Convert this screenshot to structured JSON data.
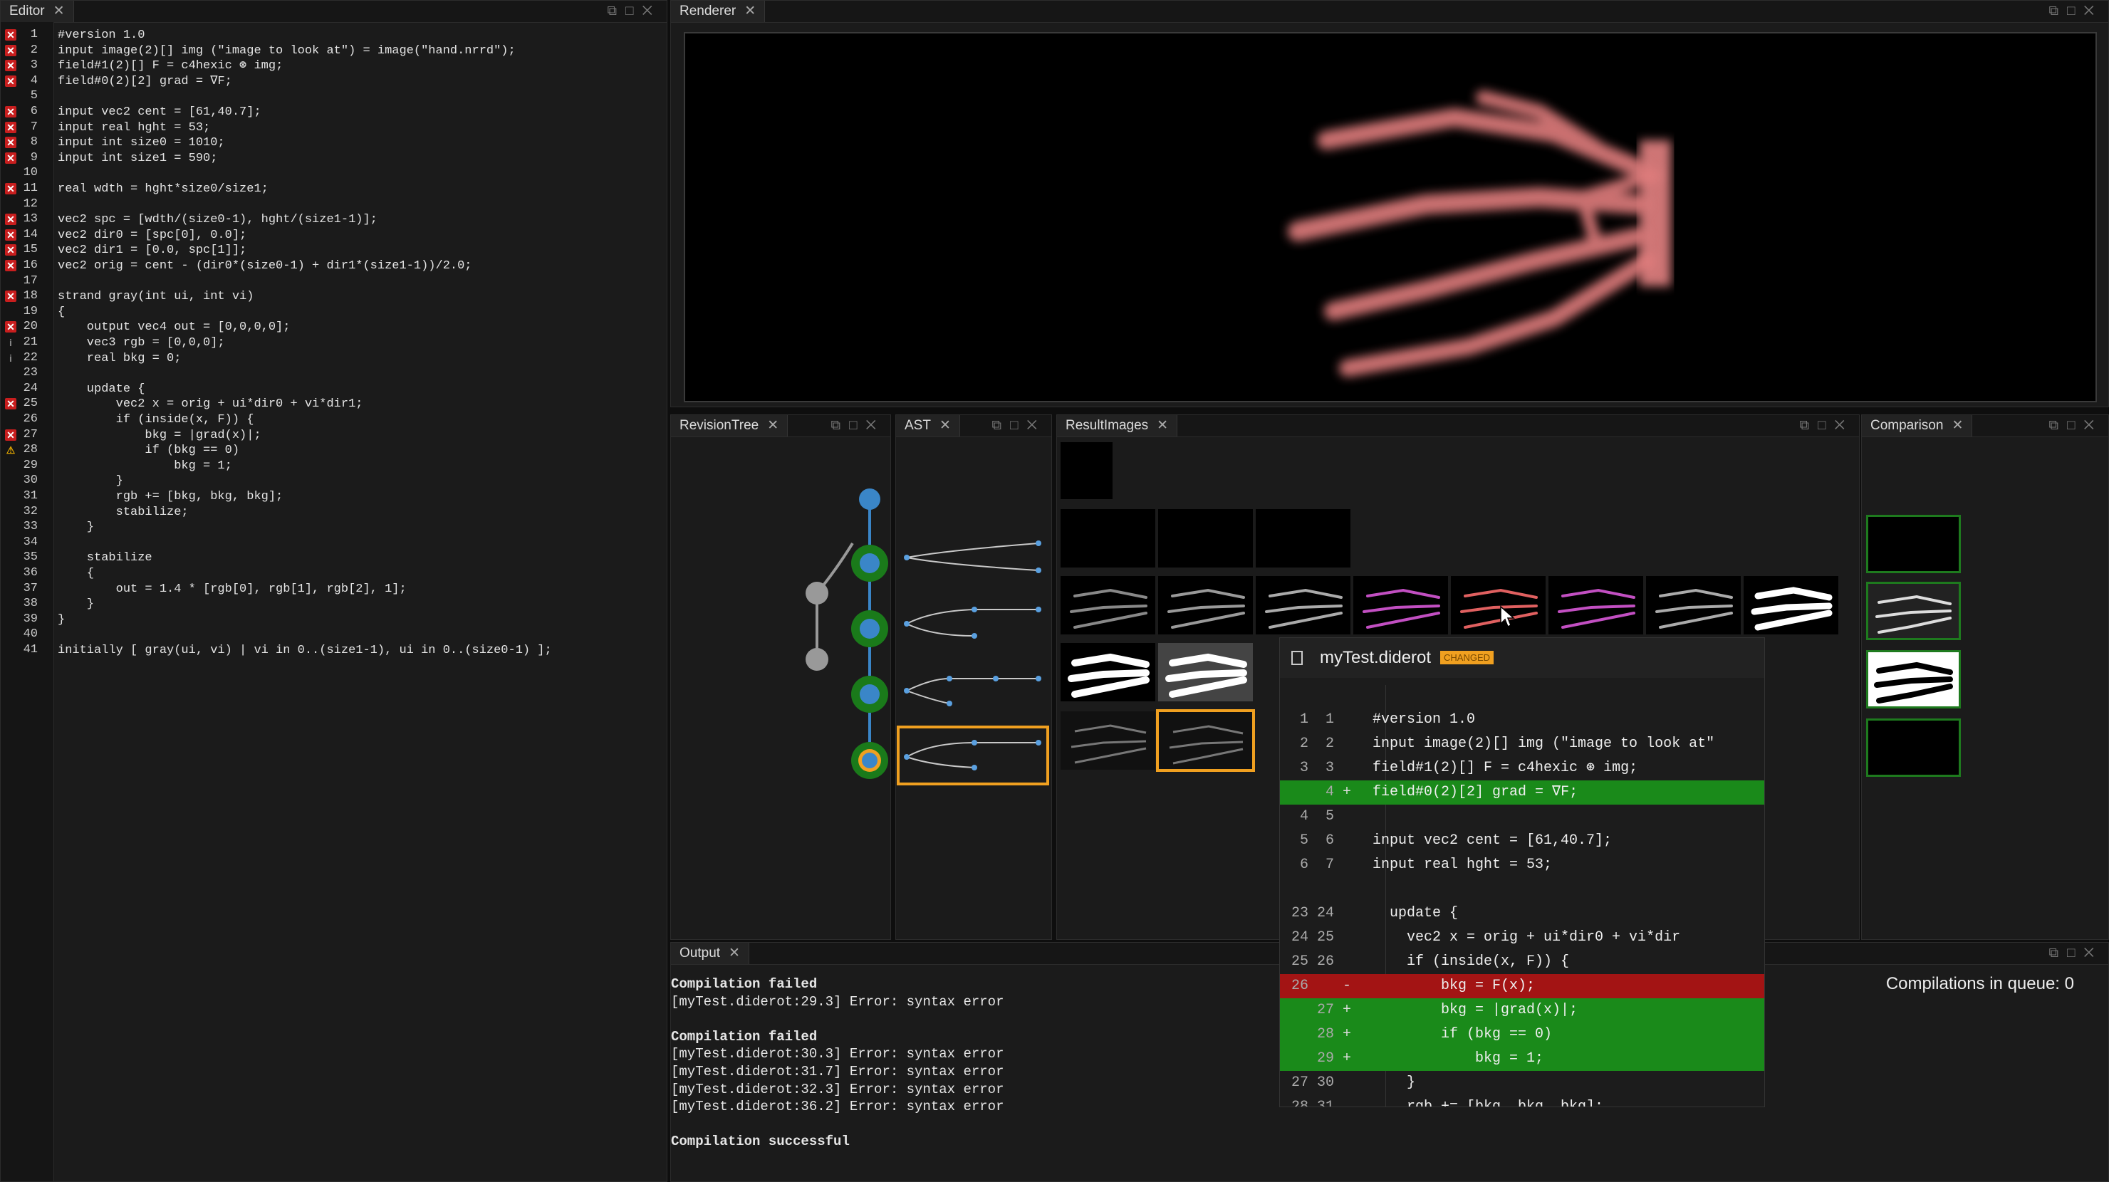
{
  "editor": {
    "tab": "Editor",
    "lines": [
      {
        "n": "1",
        "m": "err",
        "t": "#version 1.0"
      },
      {
        "n": "2",
        "m": "err",
        "t": "input image(2)[] img (\"image to look at\") = image(\"hand.nrrd\");"
      },
      {
        "n": "3",
        "m": "err",
        "t": "field#1(2)[] F = c4hexic ⊛ img;"
      },
      {
        "n": "4",
        "m": "err",
        "t": "field#0(2)[2] grad = ∇F;"
      },
      {
        "n": "5",
        "m": "",
        "t": ""
      },
      {
        "n": "6",
        "m": "err",
        "t": "input vec2 cent = [61,40.7];"
      },
      {
        "n": "7",
        "m": "err",
        "t": "input real hght = 53;"
      },
      {
        "n": "8",
        "m": "err",
        "t": "input int size0 = 1010;"
      },
      {
        "n": "9",
        "m": "err",
        "t": "input int size1 = 590;"
      },
      {
        "n": "10",
        "m": "",
        "t": ""
      },
      {
        "n": "11",
        "m": "err",
        "t": "real wdth = hght*size0/size1;"
      },
      {
        "n": "12",
        "m": "",
        "t": ""
      },
      {
        "n": "13",
        "m": "err",
        "t": "vec2 spc = [wdth/(size0-1), hght/(size1-1)];"
      },
      {
        "n": "14",
        "m": "err",
        "t": "vec2 dir0 = [spc[0], 0.0];"
      },
      {
        "n": "15",
        "m": "err",
        "t": "vec2 dir1 = [0.0, spc[1]];"
      },
      {
        "n": "16",
        "m": "err",
        "t": "vec2 orig = cent - (dir0*(size0-1) + dir1*(size1-1))/2.0;"
      },
      {
        "n": "17",
        "m": "",
        "t": ""
      },
      {
        "n": "18",
        "m": "err",
        "t": "strand gray(int ui, int vi)"
      },
      {
        "n": "19",
        "m": "",
        "t": "{"
      },
      {
        "n": "20",
        "m": "err",
        "t": "    output vec4 out = [0,0,0,0];"
      },
      {
        "n": "21",
        "m": "info",
        "t": "    vec3 rgb = [0,0,0];"
      },
      {
        "n": "22",
        "m": "info",
        "t": "    real bkg = 0;"
      },
      {
        "n": "23",
        "m": "",
        "t": ""
      },
      {
        "n": "24",
        "m": "",
        "t": "    update {"
      },
      {
        "n": "25",
        "m": "err",
        "t": "        vec2 x = orig + ui*dir0 + vi*dir1;"
      },
      {
        "n": "26",
        "m": "",
        "t": "        if (inside(x, F)) {"
      },
      {
        "n": "27",
        "m": "err",
        "t": "            bkg = |grad(x)|;"
      },
      {
        "n": "28",
        "m": "warn",
        "t": "            if (bkg == 0)"
      },
      {
        "n": "29",
        "m": "",
        "t": "                bkg = 1;"
      },
      {
        "n": "30",
        "m": "",
        "t": "        }"
      },
      {
        "n": "31",
        "m": "",
        "t": "        rgb += [bkg, bkg, bkg];"
      },
      {
        "n": "32",
        "m": "",
        "t": "        stabilize;"
      },
      {
        "n": "33",
        "m": "",
        "t": "    }"
      },
      {
        "n": "34",
        "m": "",
        "t": ""
      },
      {
        "n": "35",
        "m": "",
        "t": "    stabilize"
      },
      {
        "n": "36",
        "m": "",
        "t": "    {"
      },
      {
        "n": "37",
        "m": "",
        "t": "        out = 1.4 * [rgb[0], rgb[1], rgb[2], 1];"
      },
      {
        "n": "38",
        "m": "",
        "t": "    }"
      },
      {
        "n": "39",
        "m": "",
        "t": "}"
      },
      {
        "n": "40",
        "m": "",
        "t": ""
      },
      {
        "n": "41",
        "m": "",
        "t": "initially [ gray(ui, vi) | vi in 0..(size1-1), ui in 0..(size0-1) ];"
      }
    ]
  },
  "renderer": {
    "tab": "Renderer"
  },
  "revision_tree": {
    "tab": "RevisionTree"
  },
  "ast": {
    "tab": "AST"
  },
  "result_images": {
    "tab": "ResultImages"
  },
  "comparison": {
    "tab": "Comparison"
  },
  "diff": {
    "filename": "myTest.diderot",
    "badge": "CHANGED",
    "rows": [
      {
        "a": "1",
        "b": "1",
        "s": "",
        "t": "#version 1.0",
        "k": "n"
      },
      {
        "a": "2",
        "b": "2",
        "s": "",
        "t": "input image(2)[] img (\"image to look at\"",
        "k": "n"
      },
      {
        "a": "3",
        "b": "3",
        "s": "",
        "t": "field#1(2)[] F = c4hexic ⊛ img;",
        "k": "n"
      },
      {
        "a": "",
        "b": "4",
        "s": "+",
        "t": "field#0(2)[2] grad = ∇F;",
        "k": "add"
      },
      {
        "a": "4",
        "b": "5",
        "s": "",
        "t": "",
        "k": "n"
      },
      {
        "a": "5",
        "b": "6",
        "s": "",
        "t": "input vec2 cent = [61,40.7];",
        "k": "n"
      },
      {
        "a": "6",
        "b": "7",
        "s": "",
        "t": "input real hght = 53;",
        "k": "n"
      },
      {
        "a": "",
        "b": "",
        "s": "",
        "t": "",
        "k": "n"
      },
      {
        "a": "23",
        "b": "24",
        "s": "",
        "t": "  update {",
        "k": "n"
      },
      {
        "a": "24",
        "b": "25",
        "s": "",
        "t": "    vec2 x = orig + ui*dir0 + vi*dir",
        "k": "n"
      },
      {
        "a": "25",
        "b": "26",
        "s": "",
        "t": "    if (inside(x, F)) {",
        "k": "n"
      },
      {
        "a": "26",
        "b": "",
        "s": "-",
        "t": "        bkg = F(x);",
        "k": "del"
      },
      {
        "a": "",
        "b": "27",
        "s": "+",
        "t": "        bkg = |grad(x)|;",
        "k": "add"
      },
      {
        "a": "",
        "b": "28",
        "s": "+",
        "t": "        if (bkg == 0)",
        "k": "add"
      },
      {
        "a": "",
        "b": "29",
        "s": "+",
        "t": "            bkg = 1;",
        "k": "add"
      },
      {
        "a": "27",
        "b": "30",
        "s": "",
        "t": "    }",
        "k": "n"
      },
      {
        "a": "28",
        "b": "31",
        "s": "",
        "t": "    rgb += [bkg, bkg, bkg];",
        "k": "n"
      }
    ]
  },
  "output": {
    "tab": "Output",
    "lines": [
      {
        "t": "Compilation failed",
        "b": true
      },
      {
        "t": "[myTest.diderot:29.3] Error: syntax error",
        "b": false
      },
      {
        "t": "",
        "b": false
      },
      {
        "t": "Compilation failed",
        "b": true
      },
      {
        "t": "[myTest.diderot:30.3] Error: syntax error",
        "b": false
      },
      {
        "t": "[myTest.diderot:31.7] Error: syntax error",
        "b": false
      },
      {
        "t": "[myTest.diderot:32.3] Error: syntax error",
        "b": false
      },
      {
        "t": "[myTest.diderot:36.2] Error: syntax error",
        "b": false
      },
      {
        "t": "",
        "b": false
      },
      {
        "t": "Compilation successful",
        "b": true
      }
    ]
  },
  "queue": {
    "text": "Compilations in queue: 0"
  },
  "colors": {
    "accent_orange": "#f0a020",
    "node_blue": "#3a86c8",
    "node_green": "#1a7a1a",
    "diff_add": "#1a8a1a",
    "diff_del": "#a31414"
  }
}
